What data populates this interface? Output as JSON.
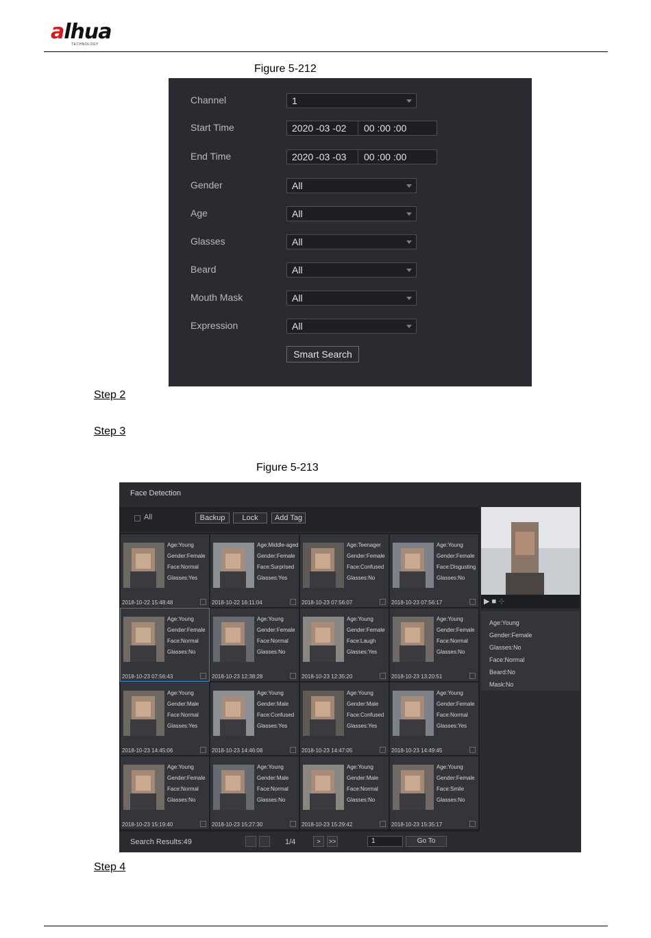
{
  "header": {
    "brand": "alhua",
    "brand_tagline": "TECHNOLOGY"
  },
  "figure_212": {
    "caption": "Figure 5-212",
    "rows": [
      {
        "label": "Channel",
        "type": "select",
        "value": "1"
      },
      {
        "label": "Start Time",
        "type": "datetime",
        "date": "2020 -03 -02",
        "time": "00 :00 :00"
      },
      {
        "label": "End Time",
        "type": "datetime",
        "date": "2020 -03 -03",
        "time": "00 :00 :00"
      },
      {
        "label": "Gender",
        "type": "select",
        "value": "All"
      },
      {
        "label": "Age",
        "type": "select",
        "value": "All"
      },
      {
        "label": "Glasses",
        "type": "select",
        "value": "All"
      },
      {
        "label": "Beard",
        "type": "select",
        "value": "All"
      },
      {
        "label": "Mouth Mask",
        "type": "select",
        "value": "All"
      },
      {
        "label": "Expression",
        "type": "select",
        "value": "All"
      }
    ],
    "button": "Smart Search"
  },
  "steps": {
    "step2": "Step 2",
    "step3": "Step 3",
    "step4": "Step 4"
  },
  "figure_213": {
    "caption": "Figure 5-213",
    "title": "Face Detection",
    "toolbar": {
      "all_label": "All",
      "backup": "Backup",
      "lock": "Lock",
      "add_tag": "Add Tag"
    },
    "cells": [
      {
        "age": "Age:Young",
        "gender": "Gender:Female",
        "face": "Face:Normal",
        "glasses": "Glasses:Yes",
        "time": "2018-10-22 15:48:48"
      },
      {
        "age": "Age:Middle-aged",
        "gender": "Gender:Female",
        "face": "Face:Surprised",
        "glasses": "Glasses:Yes",
        "time": "2018-10-22 16:11:04"
      },
      {
        "age": "Age:Teenager",
        "gender": "Gender:Female",
        "face": "Face:Confused",
        "glasses": "Glasses:No",
        "time": "2018-10-23 07:56:07"
      },
      {
        "age": "Age:Young",
        "gender": "Gender:Female",
        "face": "Face:Disgusting",
        "glasses": "Glasses:No",
        "time": "2018-10-23 07:56:17"
      },
      {
        "age": "Age:Young",
        "gender": "Gender:Female",
        "face": "Face:Normal",
        "glasses": "Glasses:No",
        "time": "2018-10-23 07:56:43"
      },
      {
        "age": "Age:Young",
        "gender": "Gender:Female",
        "face": "Face:Normal",
        "glasses": "Glasses:No",
        "time": "2018-10-23 12:38:28"
      },
      {
        "age": "Age:Young",
        "gender": "Gender:Female",
        "face": "Face:Laugh",
        "glasses": "Glasses:Yes",
        "time": "2018-10-23 12:35:20"
      },
      {
        "age": "Age:Young",
        "gender": "Gender:Female",
        "face": "Face:Normal",
        "glasses": "Glasses:No",
        "time": "2018-10-23 13:20:51"
      },
      {
        "age": "Age:Young",
        "gender": "Gender:Male",
        "face": "Face:Normal",
        "glasses": "Glasses:Yes",
        "time": "2018-10-23 14:45:06"
      },
      {
        "age": "Age:Young",
        "gender": "Gender:Male",
        "face": "Face:Confused",
        "glasses": "Glasses:Yes",
        "time": "2018-10-23 14:46:08"
      },
      {
        "age": "Age:Young",
        "gender": "Gender:Male",
        "face": "Face:Confused",
        "glasses": "Glasses:Yes",
        "time": "2018-10-23 14:47:05"
      },
      {
        "age": "Age:Young",
        "gender": "Gender:Female",
        "face": "Face:Normal",
        "glasses": "Glasses:Yes",
        "time": "2018-10-23 14:49:45"
      },
      {
        "age": "Age:Young",
        "gender": "Gender:Female",
        "face": "Face:Normal",
        "glasses": "Glasses:No",
        "time": "2018-10-23 15:19:40"
      },
      {
        "age": "Age:Young",
        "gender": "Gender:Male",
        "face": "Face:Normal",
        "glasses": "Glasses:No",
        "time": "2018-10-23 15:27:30"
      },
      {
        "age": "Age:Young",
        "gender": "Gender:Male",
        "face": "Face:Normal",
        "glasses": "Glasses:No",
        "time": "2018-10-23 15:29:42"
      },
      {
        "age": "Age:Young",
        "gender": "Gender:Female",
        "face": "Face:Smile",
        "glasses": "Glasses:No",
        "time": "2018-10-23 15:35:17"
      }
    ],
    "selected_index": 4,
    "detail": [
      "Age:Young",
      "Gender:Female",
      "Glasses:No",
      "Face:Normal",
      "Beard:No",
      "Mask:No"
    ],
    "footer": {
      "results": "Search Results:49",
      "page_info": "1/4",
      "next": ">",
      "last": ">>",
      "page_input": "1",
      "goto": "Go To"
    }
  }
}
